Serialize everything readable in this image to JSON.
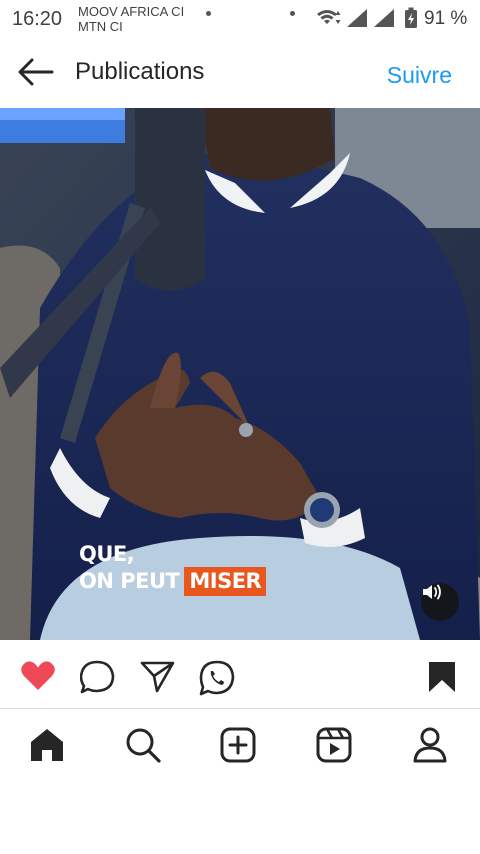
{
  "status_bar": {
    "time": "16:20",
    "carrier_line1": "MOOV AFRICA CI",
    "carrier_line2": "MTN CI",
    "battery_percent": "91 %"
  },
  "header": {
    "title": "Publications",
    "follow_label": "Suivre"
  },
  "media": {
    "caption_line1": "QUE,",
    "caption_line2_part1": "ON PEUT ",
    "caption_line2_part2": "MISER",
    "caption_highlight_color": "#e8571e"
  },
  "colors": {
    "like_active": "#ed4956",
    "follow_link": "#1a9bf0",
    "icon": "#262626"
  },
  "icons": {
    "actions": [
      "heart-icon",
      "comment-icon",
      "share-icon",
      "whatsapp-icon",
      "bookmark-icon"
    ],
    "nav": [
      "home-icon",
      "search-icon",
      "add-post-icon",
      "reels-icon",
      "profile-icon"
    ]
  }
}
